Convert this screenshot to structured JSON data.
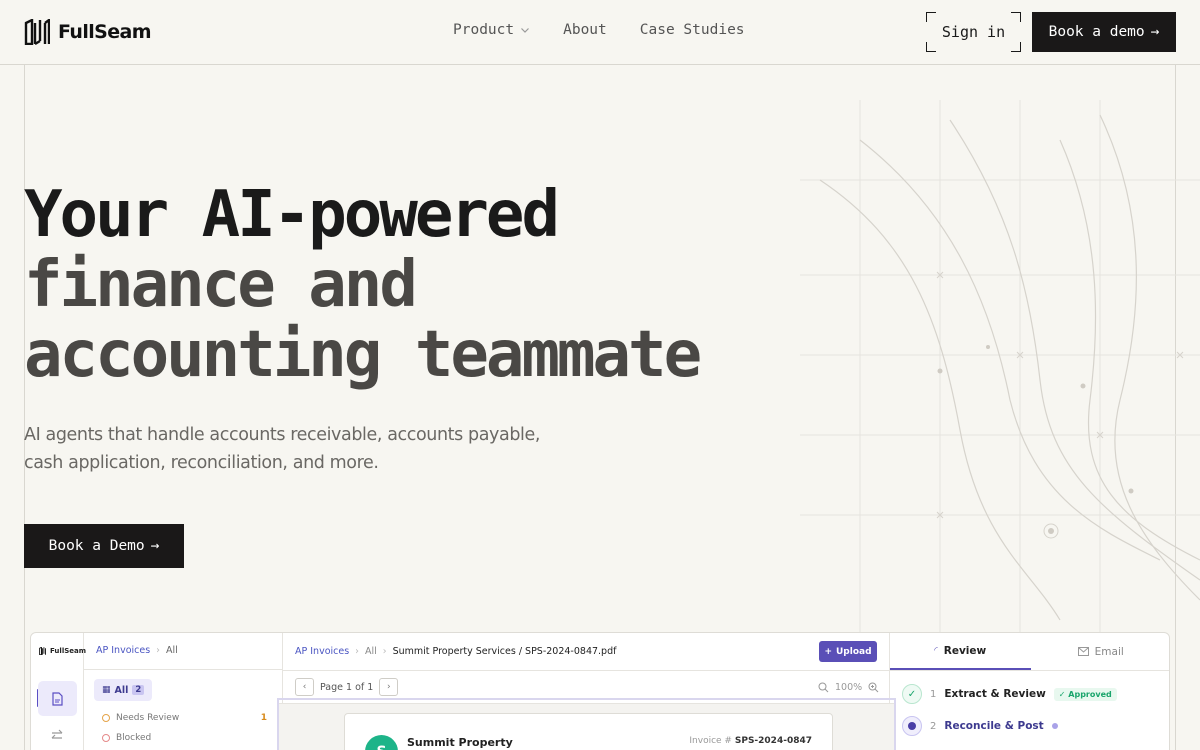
{
  "nav": {
    "brand": "FullSeam",
    "links": [
      {
        "label": "Product",
        "has_dropdown": true,
        "icon": "chevron-down-icon"
      },
      {
        "label": "About"
      },
      {
        "label": "Case Studies"
      }
    ],
    "sign_in": "Sign in",
    "book_demo": "Book a demo",
    "book_demo_arrow": "→"
  },
  "hero": {
    "title_line1": "Your AI-powered",
    "title_line2": "finance and",
    "title_line3": "accounting teammate",
    "subtitle": "AI agents that handle accounts receivable, accounts payable, cash application, reconciliation, and more.",
    "cta": "Book a Demo",
    "cta_arrow": "→"
  },
  "app_preview": {
    "rail": {
      "brand": "FullSeam"
    },
    "list": {
      "breadcrumb": [
        "AP Invoices",
        "All"
      ],
      "all_label": "All",
      "all_count": "2",
      "statuses": [
        {
          "label": "Needs Review",
          "count": "1"
        },
        {
          "label": "Blocked",
          "count": ""
        }
      ]
    },
    "document": {
      "breadcrumb": [
        "AP Invoices",
        "All",
        "Summit Property Services / SPS-2024-0847.pdf"
      ],
      "upload": "Upload",
      "pager": "Page 1 of 1",
      "zoom": "100%",
      "company_initial": "S",
      "company_name": "Summit Property",
      "invoice_label": "Invoice #",
      "invoice_number": "SPS-2024-0847"
    },
    "side": {
      "tabs": [
        {
          "label": "Review",
          "active": true
        },
        {
          "label": "Email",
          "active": false
        }
      ],
      "steps": [
        {
          "number": "1",
          "label": "Extract & Review",
          "badge": "✓ Approved",
          "state": "done"
        },
        {
          "number": "2",
          "label": "Reconcile & Post",
          "state": "current"
        }
      ]
    }
  },
  "colors": {
    "background": "#f7f6f1",
    "button_dark": "#1a1818",
    "accent_purple": "#5a4fb7",
    "success_green": "#1aa56c",
    "warning_orange": "#e5a44a"
  }
}
